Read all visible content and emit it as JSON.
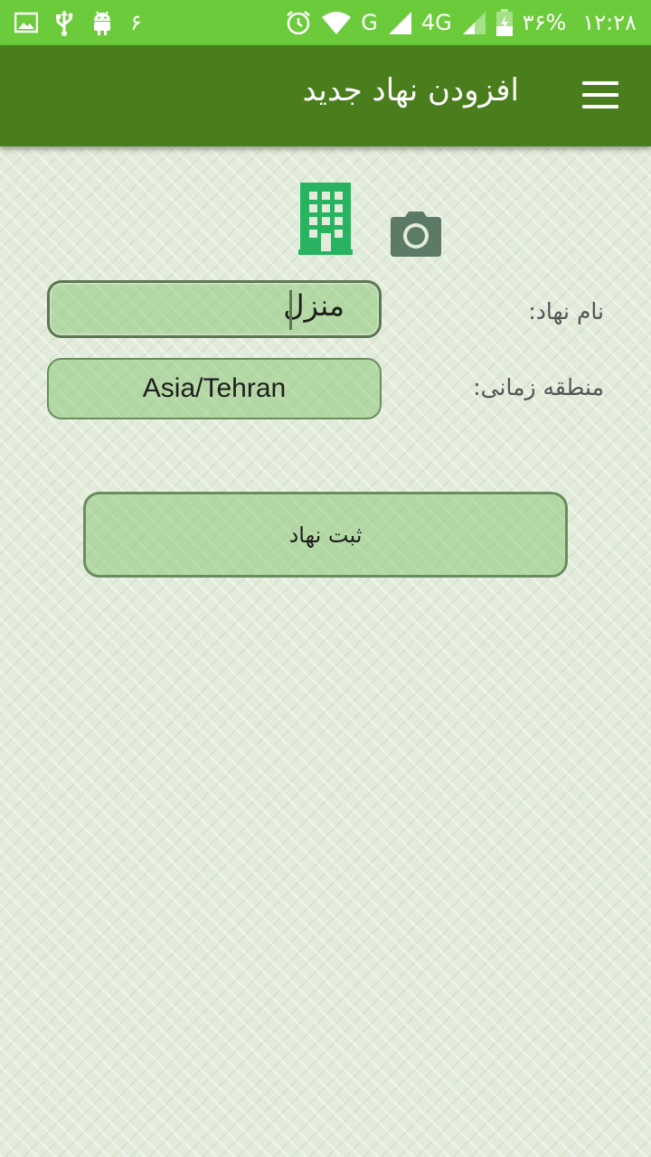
{
  "status_bar": {
    "notification_count": "۶",
    "battery_percent": "۳۶%",
    "time": "۱۲:۲۸",
    "network_g": "G",
    "network_4g": "4G",
    "icons": [
      "image-icon",
      "usb-icon",
      "android-icon",
      "alarm-icon",
      "wifi-icon",
      "signal-icon",
      "battery-icon"
    ]
  },
  "app_bar": {
    "title": "افزودن نهاد جدید",
    "menu_icon": "hamburger-menu-icon"
  },
  "header_icons": [
    "building-icon",
    "camera-icon"
  ],
  "form": {
    "name_label": "نام نهاد:",
    "name_value": "منزل",
    "timezone_label": "منطقه زمانی:",
    "timezone_value": "Asia/Tehran",
    "submit_label": "ثبت نهاد"
  },
  "colors": {
    "status_bar": "#6ccb3a",
    "app_bar": "#4a7e1d",
    "building_icon": "#27b35f",
    "camera_icon": "#5c7a66",
    "field_fill": "#a8d39a",
    "field_border": "#6a8d5e"
  }
}
